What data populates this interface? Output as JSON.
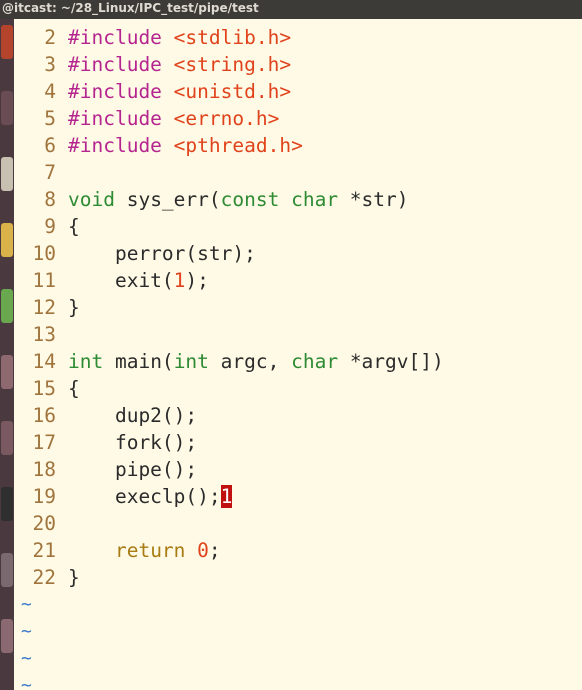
{
  "window": {
    "title": "@itcast: ~/28_Linux/IPC_test/pipe/test"
  },
  "launcher": {
    "icons": [
      "terminal-icon",
      "files-icon",
      "browser-icon",
      "chat-icon",
      "settings-icon",
      "app-icon",
      "app-icon",
      "terminal-icon",
      "app-icon",
      "app-icon"
    ]
  },
  "editor": {
    "lines": [
      {
        "num": "2",
        "tokens": [
          {
            "c": "pp",
            "t": "#include "
          },
          {
            "c": "inc",
            "t": "<stdlib.h>"
          }
        ]
      },
      {
        "num": "3",
        "tokens": [
          {
            "c": "pp",
            "t": "#include "
          },
          {
            "c": "inc",
            "t": "<string.h>"
          }
        ]
      },
      {
        "num": "4",
        "tokens": [
          {
            "c": "pp",
            "t": "#include "
          },
          {
            "c": "inc",
            "t": "<unistd.h>"
          }
        ]
      },
      {
        "num": "5",
        "tokens": [
          {
            "c": "pp",
            "t": "#include "
          },
          {
            "c": "inc",
            "t": "<errno.h>"
          }
        ]
      },
      {
        "num": "6",
        "tokens": [
          {
            "c": "pp",
            "t": "#include "
          },
          {
            "c": "inc",
            "t": "<pthread.h>"
          }
        ]
      },
      {
        "num": "7",
        "tokens": []
      },
      {
        "num": "8",
        "tokens": [
          {
            "c": "ty",
            "t": "void"
          },
          {
            "c": "",
            "t": " sys_err("
          },
          {
            "c": "ty",
            "t": "const"
          },
          {
            "c": "",
            "t": " "
          },
          {
            "c": "ty",
            "t": "char"
          },
          {
            "c": "",
            "t": " *str)"
          }
        ]
      },
      {
        "num": "9",
        "tokens": [
          {
            "c": "",
            "t": "{"
          }
        ]
      },
      {
        "num": "10",
        "tokens": [
          {
            "c": "",
            "t": "    perror(str);"
          }
        ]
      },
      {
        "num": "11",
        "tokens": [
          {
            "c": "",
            "t": "    exit("
          },
          {
            "c": "num",
            "t": "1"
          },
          {
            "c": "",
            "t": ");"
          }
        ]
      },
      {
        "num": "12",
        "tokens": [
          {
            "c": "",
            "t": "}"
          }
        ]
      },
      {
        "num": "13",
        "tokens": []
      },
      {
        "num": "14",
        "tokens": [
          {
            "c": "ty",
            "t": "int"
          },
          {
            "c": "",
            "t": " main("
          },
          {
            "c": "ty",
            "t": "int"
          },
          {
            "c": "",
            "t": " argc, "
          },
          {
            "c": "ty",
            "t": "char"
          },
          {
            "c": "",
            "t": " *argv[])"
          }
        ]
      },
      {
        "num": "15",
        "tokens": [
          {
            "c": "",
            "t": "{"
          }
        ]
      },
      {
        "num": "16",
        "tokens": [
          {
            "c": "",
            "t": "    dup2();"
          }
        ]
      },
      {
        "num": "17",
        "tokens": [
          {
            "c": "",
            "t": "    fork();"
          }
        ]
      },
      {
        "num": "18",
        "tokens": [
          {
            "c": "",
            "t": "    pipe();"
          }
        ]
      },
      {
        "num": "19",
        "tokens": [
          {
            "c": "",
            "t": "    execlp();"
          },
          {
            "c": "cursor",
            "t": "1"
          }
        ]
      },
      {
        "num": "20",
        "tokens": []
      },
      {
        "num": "21",
        "tokens": [
          {
            "c": "",
            "t": "    "
          },
          {
            "c": "kw",
            "t": "return"
          },
          {
            "c": "",
            "t": " "
          },
          {
            "c": "num",
            "t": "0"
          },
          {
            "c": "",
            "t": ";"
          }
        ]
      },
      {
        "num": "22",
        "tokens": [
          {
            "c": "",
            "t": "}"
          }
        ]
      }
    ],
    "tilde": [
      "~",
      "~",
      "~",
      "~"
    ]
  }
}
